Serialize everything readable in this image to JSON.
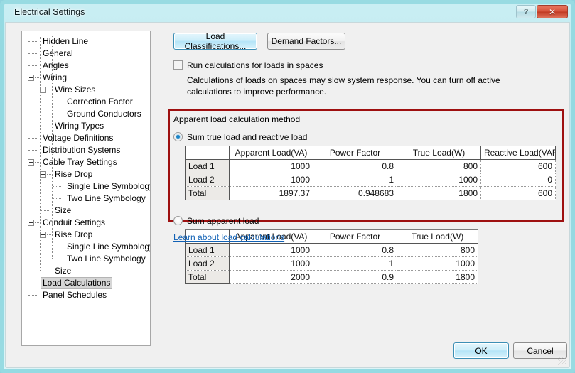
{
  "window": {
    "title": "Electrical Settings",
    "help_button": "?",
    "close_button": "✕"
  },
  "tree": {
    "items": [
      {
        "label": "Hidden Line",
        "depth": 0,
        "expander": "",
        "selected": false
      },
      {
        "label": "General",
        "depth": 0,
        "expander": "",
        "selected": false
      },
      {
        "label": "Angles",
        "depth": 0,
        "expander": "",
        "selected": false
      },
      {
        "label": "Wiring",
        "depth": 0,
        "expander": "minus",
        "selected": false
      },
      {
        "label": "Wire Sizes",
        "depth": 1,
        "expander": "minus",
        "selected": false
      },
      {
        "label": "Correction Factor",
        "depth": 2,
        "expander": "",
        "selected": false
      },
      {
        "label": "Ground Conductors",
        "depth": 2,
        "expander": "",
        "selected": false
      },
      {
        "label": "Wiring Types",
        "depth": 1,
        "expander": "",
        "selected": false
      },
      {
        "label": "Voltage Definitions",
        "depth": 0,
        "expander": "",
        "selected": false
      },
      {
        "label": "Distribution Systems",
        "depth": 0,
        "expander": "",
        "selected": false
      },
      {
        "label": "Cable Tray Settings",
        "depth": 0,
        "expander": "minus",
        "selected": false
      },
      {
        "label": "Rise Drop",
        "depth": 1,
        "expander": "minus",
        "selected": false
      },
      {
        "label": "Single Line Symbology",
        "depth": 2,
        "expander": "",
        "selected": false
      },
      {
        "label": "Two Line Symbology",
        "depth": 2,
        "expander": "",
        "selected": false
      },
      {
        "label": "Size",
        "depth": 1,
        "expander": "",
        "selected": false
      },
      {
        "label": "Conduit Settings",
        "depth": 0,
        "expander": "minus",
        "selected": false
      },
      {
        "label": "Rise Drop",
        "depth": 1,
        "expander": "minus",
        "selected": false
      },
      {
        "label": "Single Line Symbology",
        "depth": 2,
        "expander": "",
        "selected": false
      },
      {
        "label": "Two Line Symbology",
        "depth": 2,
        "expander": "",
        "selected": false
      },
      {
        "label": "Size",
        "depth": 1,
        "expander": "",
        "selected": false
      },
      {
        "label": "Load Calculations",
        "depth": 0,
        "expander": "",
        "selected": true
      },
      {
        "label": "Panel Schedules",
        "depth": 0,
        "expander": "",
        "selected": false
      }
    ]
  },
  "toolbar": {
    "load_classifications_label": "Load Classifications...",
    "demand_factors_label": "Demand Factors..."
  },
  "options": {
    "run_calculations_label": "Run calculations for loads in spaces",
    "run_calculations_checked": false,
    "description": "Calculations of loads on spaces may slow system response. You can turn off active calculations to improve performance."
  },
  "apparent_load": {
    "group_label": "Apparent load calculation method",
    "method_1": {
      "label": "Sum true load and reactive load",
      "selected": true,
      "table": {
        "columns": [
          "",
          "Apparent Load(VA)",
          "Power Factor",
          "True Load(W)",
          "Reactive Load(VAR)"
        ],
        "rows": [
          {
            "label": "Load 1",
            "values": [
              "1000",
              "0.8",
              "800",
              "600"
            ]
          },
          {
            "label": "Load 2",
            "values": [
              "1000",
              "1",
              "1000",
              "0"
            ]
          },
          {
            "label": "Total",
            "values": [
              "1897.37",
              "0.948683",
              "1800",
              "600"
            ]
          }
        ]
      }
    },
    "method_2": {
      "label": "Sum apparent load",
      "selected": false,
      "table": {
        "columns": [
          "",
          "Apparent Load(VA)",
          "Power Factor",
          "True Load(W)"
        ],
        "rows": [
          {
            "label": "Load 1",
            "values": [
              "1000",
              "0.8",
              "800"
            ]
          },
          {
            "label": "Load 2",
            "values": [
              "1000",
              "1",
              "1000"
            ]
          },
          {
            "label": "Total",
            "values": [
              "2000",
              "0.9",
              "1800"
            ]
          }
        ]
      }
    }
  },
  "help_link": {
    "label": "Learn about load calculations"
  },
  "footer": {
    "ok_label": "OK",
    "cancel_label": "Cancel"
  },
  "colors": {
    "annotation_red": "#9e1010",
    "accent_cyan": "#8cd6de",
    "link_blue": "#1161b5",
    "radio_blue": "#1c84c6"
  }
}
